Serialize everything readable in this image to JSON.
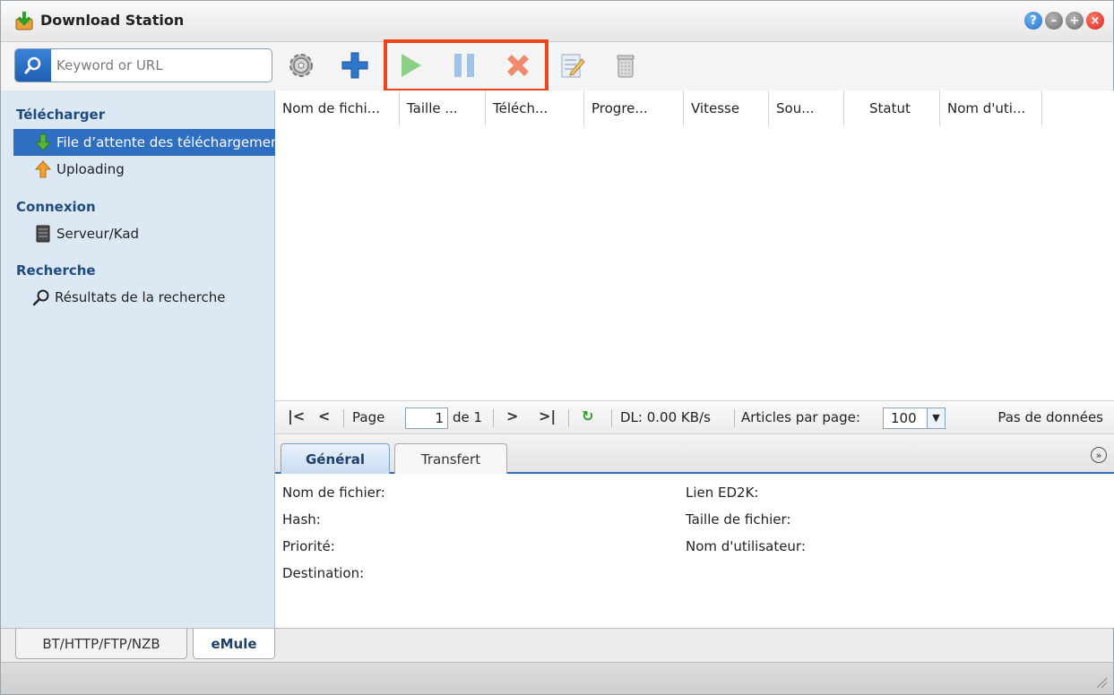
{
  "window": {
    "title": "Download Station"
  },
  "search": {
    "placeholder": "Keyword or URL"
  },
  "toolbar": {
    "icons": [
      "gear-icon",
      "add-icon",
      "play-icon",
      "pause-icon",
      "delete-icon",
      "edit-icon",
      "trash-icon"
    ]
  },
  "sidebar": {
    "sections": [
      {
        "header": "Télécharger",
        "items": [
          {
            "label": "File d’attente des téléchargements"
          },
          {
            "label": "Uploading"
          }
        ]
      },
      {
        "header": "Connexion",
        "items": [
          {
            "label": "Serveur/Kad"
          }
        ]
      },
      {
        "header": "Recherche",
        "items": [
          {
            "label": "Résultats de la recherche"
          }
        ]
      }
    ]
  },
  "grid": {
    "columns": [
      "Nom de fichi...",
      "Taille ...",
      "Téléch...",
      "Progre...",
      "Vitesse",
      "Sou...",
      "Statut",
      "Nom d'uti..."
    ]
  },
  "pager": {
    "page_label": "Page",
    "page_value": "1",
    "of_label": "de 1",
    "dl_speed": "DL: 0.00 KB/s",
    "per_page_label": "Articles par page:",
    "per_page_value": "100",
    "no_data": "Pas de données"
  },
  "detail": {
    "tabs": [
      "Général",
      "Transfert"
    ],
    "fields_left": [
      "Nom de fichier:",
      "Hash:",
      "Priorité:",
      "Destination:"
    ],
    "fields_right": [
      "Lien ED2K:",
      "Taille de fichier:",
      "Nom d'utilisateur:"
    ]
  },
  "bottom_tabs": [
    "BT/HTTP/FTP/NZB",
    "eMule"
  ],
  "colors": {
    "accent": "#2f6fc1",
    "highlight": "#f04317",
    "sidebar_bg": "#dde8f5"
  }
}
